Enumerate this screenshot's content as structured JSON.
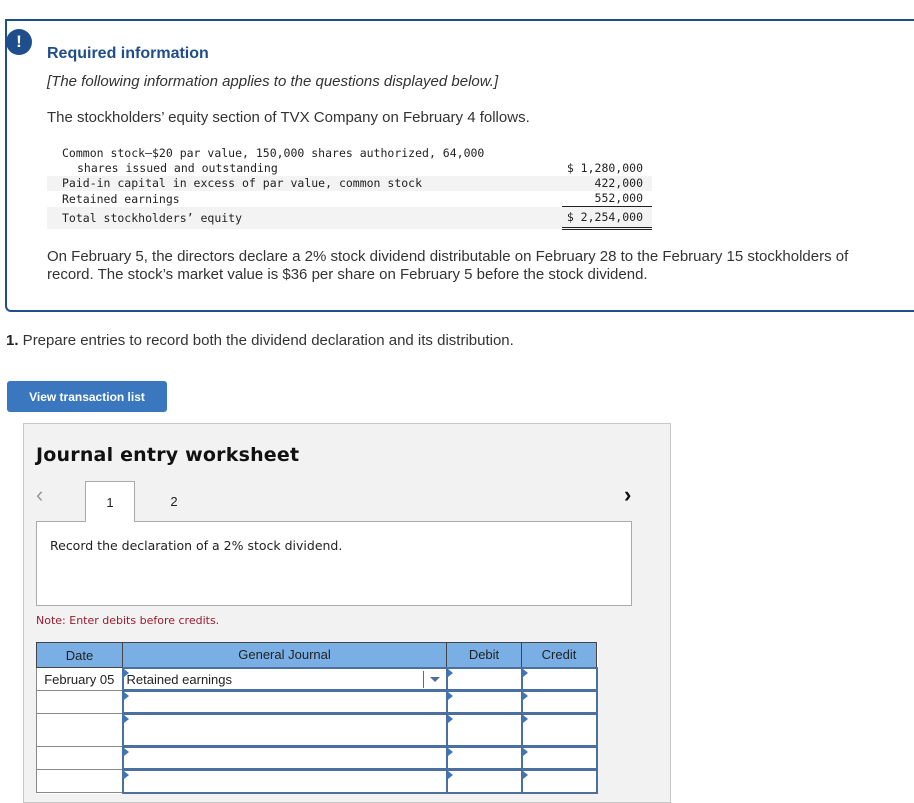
{
  "info": {
    "badge": "!",
    "title": "Required information",
    "subtitle": "[The following information applies to the questions displayed below.]",
    "intro": "The stockholders’ equity section of TVX Company on February 4 follows.",
    "equity": {
      "rows": [
        {
          "label": "Common stock–$20 par value, 150,000 shares authorized, 64,000",
          "amount": ""
        },
        {
          "label": "shares issued and outstanding",
          "amount": "$ 1,280,000"
        },
        {
          "label": "Paid-in capital in excess of par value, common stock",
          "amount": "422,000"
        },
        {
          "label": "Retained earnings",
          "amount": "552,000"
        },
        {
          "label": "Total stockholders’ equity",
          "amount": "$ 2,254,000"
        }
      ]
    },
    "scenario": "On February 5, the directors declare a 2% stock dividend distributable on February 28 to the February 15 stockholders of record. The stock’s market value is $36 per share on February 5 before the stock dividend."
  },
  "question": {
    "number": "1.",
    "text": " Prepare entries to record both the dividend declaration and its distribution."
  },
  "view_transaction_button": "View transaction list",
  "worksheet": {
    "title": "Journal entry worksheet",
    "prev_icon": "‹",
    "next_icon": "›",
    "tabs": [
      {
        "label": "1",
        "active": true
      },
      {
        "label": "2",
        "active": false
      }
    ],
    "prompt": "Record the declaration of a 2% stock dividend.",
    "note": "Note: Enter debits before credits.",
    "table": {
      "headers": {
        "date": "Date",
        "journal": "General Journal",
        "debit": "Debit",
        "credit": "Credit"
      },
      "rows": [
        {
          "date": "February 05",
          "account": "Retained earnings",
          "debit": "",
          "credit": "",
          "dropdown": true
        },
        {
          "date": "",
          "account": "",
          "debit": "",
          "credit": ""
        },
        {
          "date": "",
          "account": "",
          "debit": "",
          "credit": ""
        },
        {
          "date": "",
          "account": "",
          "debit": "",
          "credit": ""
        },
        {
          "date": "",
          "account": "",
          "debit": "",
          "credit": ""
        }
      ]
    }
  },
  "colors": {
    "brand_navy": "#1f4e8c",
    "button_blue": "#3a77bf",
    "header_blue": "#7aafe6",
    "note_red": "#9b1b30"
  }
}
